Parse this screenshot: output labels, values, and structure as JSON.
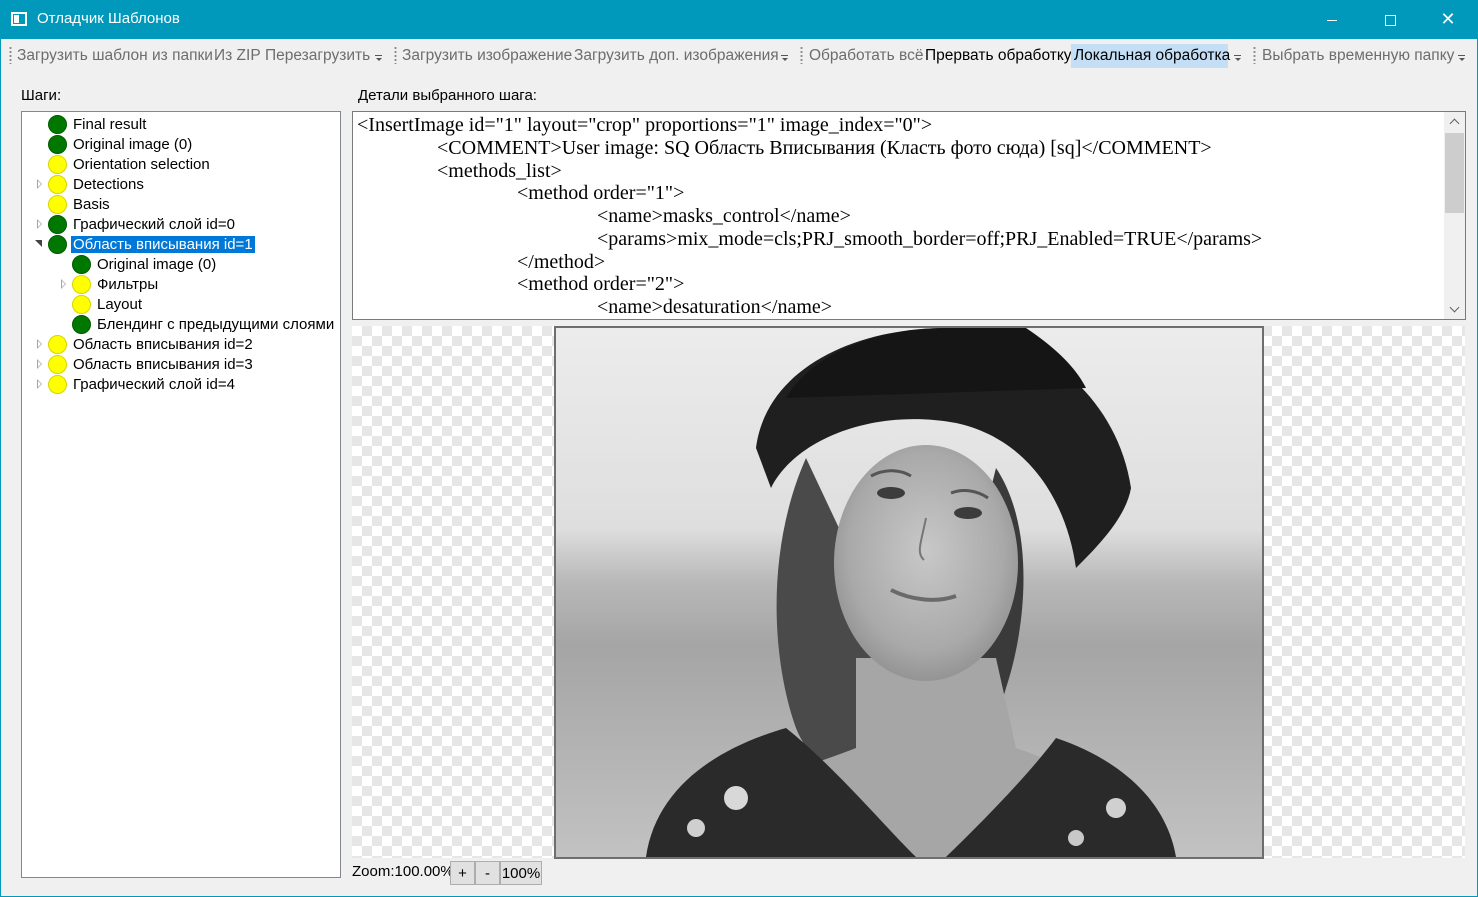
{
  "window": {
    "title": "Отладчик Шаблонов"
  },
  "toolbar": {
    "load_template_folder": "Загрузить шаблон из папки",
    "from_zip": "Из ZIP",
    "reload": "Перезагрузить",
    "load_image": "Загрузить изображение",
    "load_extra_images": "Загрузить доп. изображения",
    "process_all": "Обработать всё",
    "abort_processing": "Прервать обработку",
    "local_processing": "Локальная обработка",
    "select_temp_folder": "Выбрать временную папку"
  },
  "steps": {
    "label": "Шаги:",
    "items": [
      {
        "label": "Final result",
        "status": "green"
      },
      {
        "label": "Original image (0)",
        "status": "green"
      },
      {
        "label": "Orientation selection",
        "status": "yellow"
      },
      {
        "label": "Detections",
        "status": "yellow"
      },
      {
        "label": "Basis",
        "status": "yellow"
      },
      {
        "label": "Графический слой id=0",
        "status": "green"
      },
      {
        "label": "Область вписывания id=1",
        "status": "green"
      },
      {
        "label": "Original image (0)",
        "status": "green"
      },
      {
        "label": "Фильтры",
        "status": "yellow"
      },
      {
        "label": "Layout",
        "status": "yellow"
      },
      {
        "label": "Блендинг с предыдущими слоями",
        "status": "green"
      },
      {
        "label": "Область вписывания id=2",
        "status": "yellow"
      },
      {
        "label": "Область вписывания id=3",
        "status": "yellow"
      },
      {
        "label": "Графический слой id=4",
        "status": "yellow"
      }
    ]
  },
  "details": {
    "label": "Детали выбранного шага:",
    "lines": [
      "<InsertImage id=\"1\" layout=\"crop\" proportions=\"1\" image_index=\"0\">",
      "<COMMENT>User image: SQ Область Вписывания (Класть фото сюда) [sq]</COMMENT>",
      "<methods_list>",
      "<method order=\"1\">",
      "<name>masks_control</name>",
      "<params>mix_mode=cls;PRJ_smooth_border=off;PRJ_Enabled=TRUE</params>",
      "</method>",
      "<method order=\"2\">",
      "<name>desaturation</name>"
    ]
  },
  "zoom": {
    "label": "Zoom:100.00%",
    "plus": "+",
    "minus": "-",
    "reset": "100%"
  },
  "colors": {
    "titlebar": "#0099bc",
    "status_green": "#007800",
    "status_yellow": "#ffff00",
    "selection": "#0078d7",
    "active_toggle": "#c3def5"
  }
}
